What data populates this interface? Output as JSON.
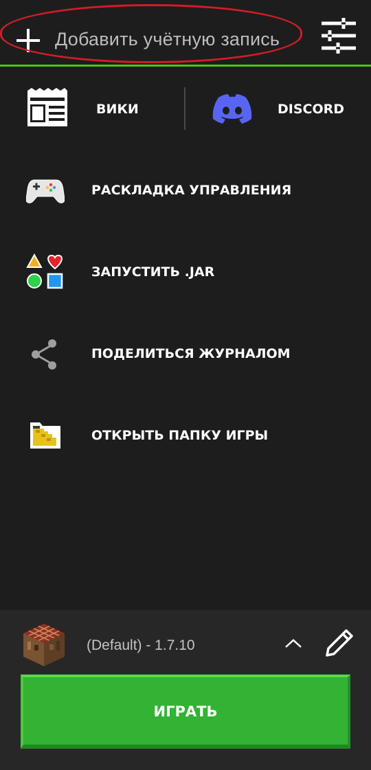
{
  "header": {
    "account_label": "Добавить учётную запись"
  },
  "quick_links": {
    "wiki_label": "ВИКИ",
    "discord_label": "DISCORD"
  },
  "menu": {
    "items": [
      {
        "label": "РАСКЛАДКА УПРАВЛЕНИЯ",
        "icon": "gamepad-icon"
      },
      {
        "label": "ЗАПУСТИТЬ .JAR",
        "icon": "shapes-icon"
      },
      {
        "label": "ПОДЕЛИТЬСЯ ЖУРНАЛОМ",
        "icon": "share-icon"
      },
      {
        "label": "ОТКРЫТЬ ПАПКУ ИГРЫ",
        "icon": "folder-icon"
      }
    ]
  },
  "footer": {
    "version_label": "(Default) - 1.7.10",
    "play_label": "ИГРАТЬ"
  },
  "colors": {
    "accent": "#4fc21a",
    "play": "#33b233",
    "highlight": "#d41c26",
    "discord": "#5865f2"
  }
}
